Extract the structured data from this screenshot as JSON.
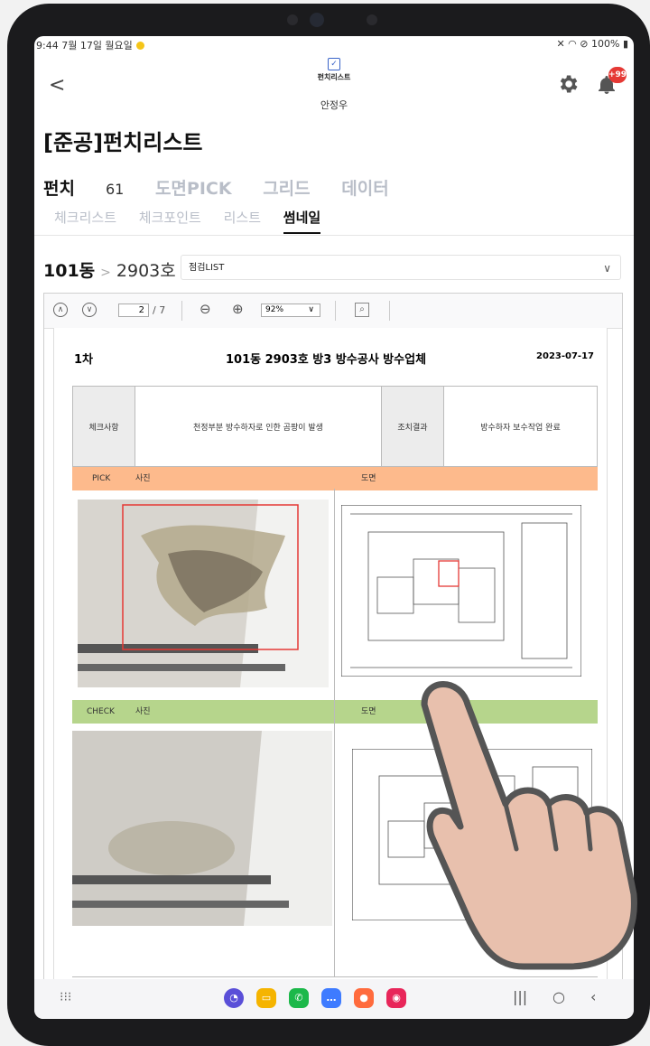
{
  "status": {
    "time": "9:44",
    "date": "7월 17일 월요일",
    "battery": "100%"
  },
  "header": {
    "back": "<",
    "logo_text": "펀치리스트",
    "user": "안정우",
    "badge": "+99"
  },
  "page_title": "[준공]펀치리스트",
  "tabs": [
    {
      "label": "펀치",
      "count": "61"
    },
    {
      "label": "도면PICK"
    },
    {
      "label": "그리드"
    },
    {
      "label": "데이터"
    }
  ],
  "subtabs": [
    "체크리스트",
    "체크포인트",
    "리스트",
    "썸네일"
  ],
  "breadcrumb": {
    "building": "101동",
    "sep": ">",
    "unit": "2903호"
  },
  "select": {
    "value": "점검LIST"
  },
  "viewer": {
    "page": "2",
    "total": "/ 7",
    "zoom": "92%"
  },
  "doc": {
    "round": "1차",
    "title": "101동 2903호 방3 방수공사 방수업체",
    "date": "2023-07-17",
    "check_label": "체크사항",
    "check_value": "천정부분 방수하자로 인한 곰팡이 발생",
    "result_label": "조치결과",
    "result_value": "방수하자 보수작업 완료",
    "pick_label": "PICK",
    "photo_label": "사진",
    "plan_label": "도면",
    "check_bar_label": "CHECK"
  },
  "colors": {
    "pick_bar": "#fdba8c",
    "check_bar": "#b6d58c",
    "accent": "#e53935"
  },
  "nav": {
    "apps": [
      "bixby-icon",
      "folder-icon",
      "phone-icon",
      "messages-icon",
      "contacts-icon",
      "camera-icon"
    ]
  }
}
